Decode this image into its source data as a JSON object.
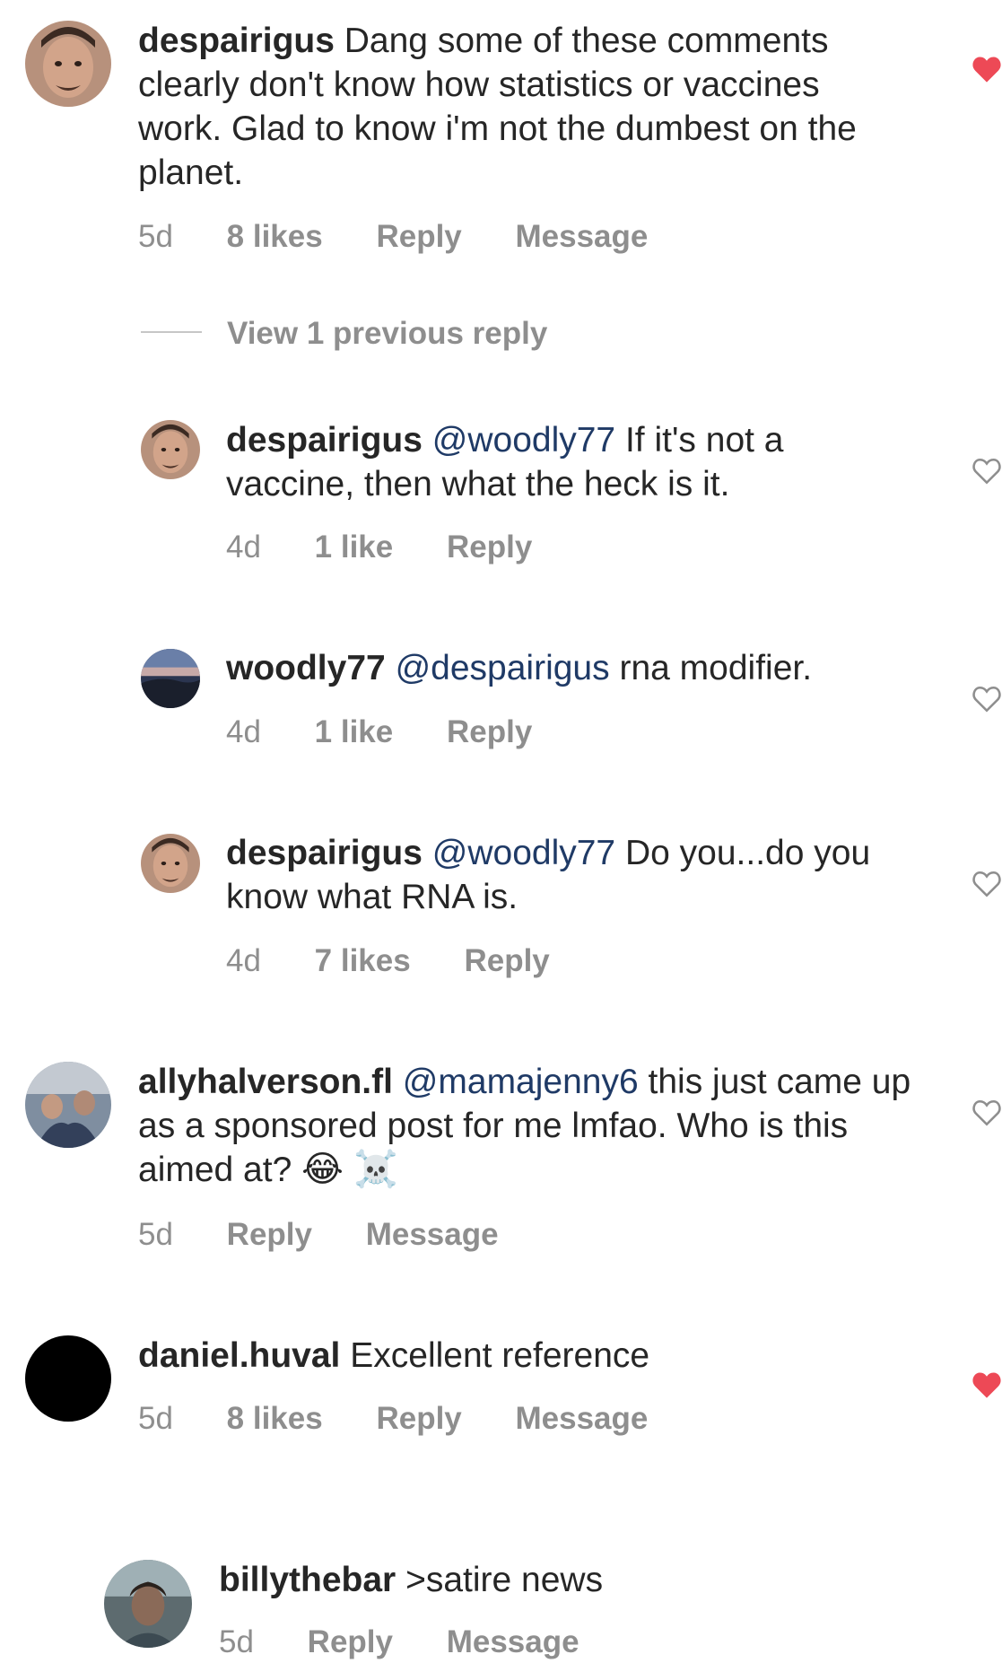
{
  "comments": [
    {
      "username": "despairigus",
      "mention": "",
      "text": "Dang some of these comments clearly don't know how statistics or vaccines work. Glad to know i'm not the dumbest on the planet.",
      "time": "5d",
      "likes": "8 likes",
      "reply": "Reply",
      "message": "Message",
      "liked": true
    },
    {
      "username": "despairigus",
      "mention": "@woodly77",
      "text": "If it's not a vaccine, then what the heck is it.",
      "time": "4d",
      "likes": "1 like",
      "reply": "Reply",
      "liked": false
    },
    {
      "username": "woodly77",
      "mention": "@despairigus",
      "text": "rna modifier.",
      "time": "4d",
      "likes": "1 like",
      "reply": "Reply",
      "liked": false
    },
    {
      "username": "despairigus",
      "mention": "@woodly77",
      "text": "Do you...do you know what RNA is.",
      "time": "4d",
      "likes": "7 likes",
      "reply": "Reply",
      "liked": false
    },
    {
      "username": "allyhalverson.fl",
      "mention": "@mamajenny6",
      "text": "this just came up as a sponsored post for me lmfao. Who is this aimed at?",
      "emojis": "😂 ☠️",
      "time": "5d",
      "reply": "Reply",
      "message": "Message",
      "liked": false
    },
    {
      "username": "daniel.huval",
      "mention": "",
      "text": "Excellent reference",
      "time": "5d",
      "likes": "8 likes",
      "reply": "Reply",
      "message": "Message",
      "liked": true
    },
    {
      "username": "billythebar",
      "mention": "",
      "text": ">satire news",
      "time": "5d",
      "reply": "Reply",
      "message": "Message",
      "liked": false
    }
  ],
  "view_previous": "View 1 previous reply",
  "colors": {
    "text": "#262626",
    "meta": "#8e8e8e",
    "mention": "#1f3a66",
    "liked_heart": "#ed4956",
    "outline_heart": "#8e8e8e"
  },
  "icons": {
    "liked": "heart-filled-icon",
    "unliked": "heart-outline-icon"
  }
}
